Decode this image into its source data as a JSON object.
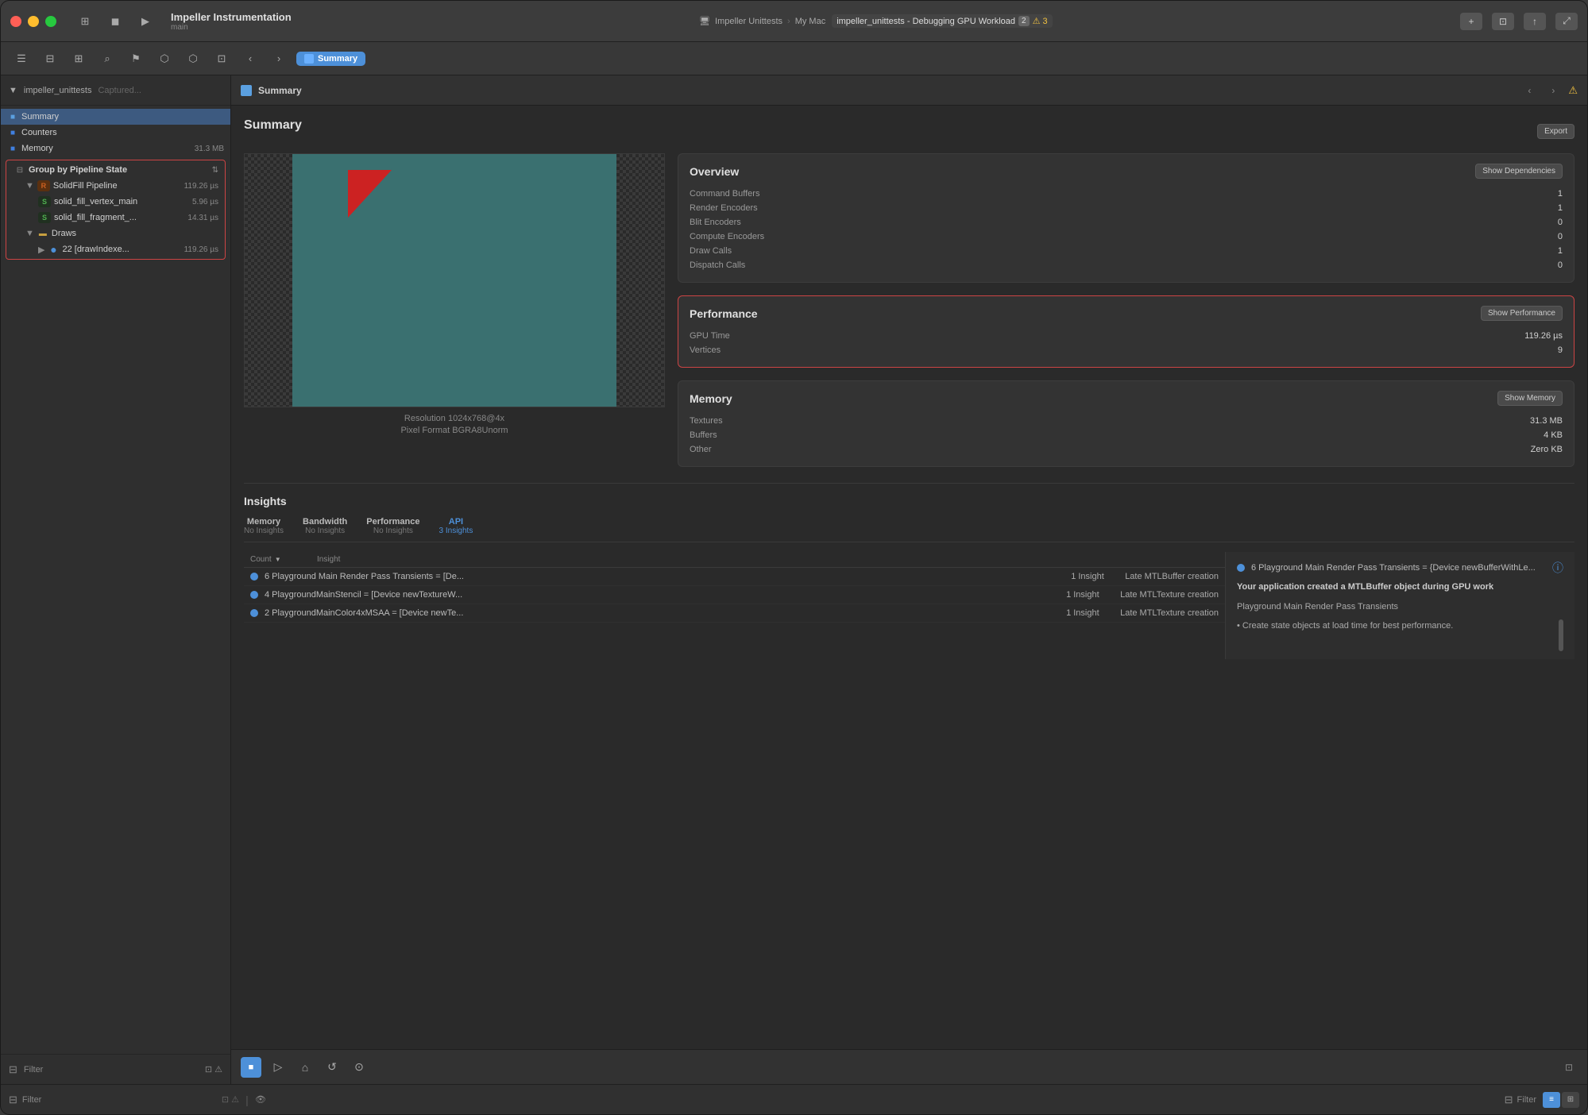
{
  "window": {
    "title": "Impeller Instrumentation",
    "subtitle": "main"
  },
  "titlebar": {
    "breadcrumb": [
      "Impeller Unittests",
      "My Mac"
    ],
    "debug_label": "impeller_unittests - Debugging GPU Workload",
    "debug_count": "2",
    "warn_count": "3",
    "add_btn": "+",
    "split_btn": "⊡"
  },
  "toolbar": {
    "back_btn": "‹",
    "forward_btn": "›",
    "tab_label": "Summary",
    "tab_icon": "■"
  },
  "panel_header": {
    "title": "Summary"
  },
  "sidebar": {
    "project": "impeller_unittests",
    "project_suffix": "Captured...",
    "items": [
      {
        "id": "summary",
        "label": "Summary",
        "icon": "■",
        "icon_color": "blue",
        "selected": true
      },
      {
        "id": "counters",
        "label": "Counters",
        "icon": "■",
        "icon_color": "blue",
        "selected": false
      },
      {
        "id": "memory",
        "label": "Memory",
        "icon": "■",
        "icon_color": "blue",
        "value": "31.3 MB",
        "selected": false
      }
    ],
    "group_label": "Group by Pipeline State",
    "pipeline": {
      "label": "SolidFill Pipeline",
      "value": "119.26 µs",
      "icon": "R"
    },
    "shaders": [
      {
        "label": "solid_fill_vertex_main",
        "value": "5.96 µs",
        "icon": "S"
      },
      {
        "label": "solid_fill_fragment_...",
        "value": "14.31 µs",
        "icon": "S"
      }
    ],
    "draws_label": "Draws",
    "draw_call": {
      "label": "22 [drawIndexe...",
      "value": "119.26 µs",
      "icon": "●"
    },
    "filter_label": "Filter"
  },
  "main": {
    "summary_title": "Summary",
    "export_btn": "Export",
    "preview": {
      "resolution": "Resolution  1024x768@4x",
      "pixel_format": "Pixel Format  BGRA8Unorm"
    },
    "overview": {
      "title": "Overview",
      "show_deps_btn": "Show Dependencies",
      "stats": [
        {
          "label": "Command Buffers",
          "value": "1"
        },
        {
          "label": "Render Encoders",
          "value": "1"
        },
        {
          "label": "Blit Encoders",
          "value": "0"
        },
        {
          "label": "Compute Encoders",
          "value": "0"
        },
        {
          "label": "Draw Calls",
          "value": "1"
        },
        {
          "label": "Dispatch Calls",
          "value": "0"
        }
      ]
    },
    "performance": {
      "title": "Performance",
      "show_perf_btn": "Show Performance",
      "stats": [
        {
          "label": "GPU Time",
          "value": "119.26 µs"
        },
        {
          "label": "Vertices",
          "value": "9"
        }
      ]
    },
    "memory": {
      "title": "Memory",
      "show_mem_btn": "Show Memory",
      "stats": [
        {
          "label": "Textures",
          "value": "31.3 MB"
        },
        {
          "label": "Buffers",
          "value": "4 KB"
        },
        {
          "label": "Other",
          "value": "Zero KB"
        }
      ]
    },
    "insights": {
      "title": "Insights",
      "tabs": [
        {
          "label": "Memory",
          "sub": "No Insights",
          "active": false
        },
        {
          "label": "Bandwidth",
          "sub": "No Insights",
          "active": false
        },
        {
          "label": "Performance",
          "sub": "No Insights",
          "active": false
        },
        {
          "label": "API",
          "sub": "3 Insights",
          "active": true
        }
      ],
      "table_headers": {
        "count": "Count",
        "insight": "Insight"
      },
      "rows": [
        {
          "text": "6 Playground Main Render Pass Transients = [De...",
          "count": "1 Insight",
          "type": "Late MTLBuffer creation"
        },
        {
          "text": "4 PlaygroundMainStencil = [Device newTextureW...",
          "count": "1 Insight",
          "type": "Late MTLTexture creation"
        },
        {
          "text": "2 PlaygroundMainColor4xMSAA = [Device newTe...",
          "count": "1 Insight",
          "type": "Late MTLTexture creation"
        }
      ],
      "detail": {
        "title": "6 Playground Main Render Pass Transients = {Device newBufferWithLe...",
        "status_icon": "ⓘ",
        "description": "Your application created a MTLBuffer object during GPU work",
        "sub_label": "Playground Main Render Pass Transients",
        "tip": "• Create state objects at load time for best performance."
      }
    }
  },
  "bottom_toolbar": {
    "record_btn": "■",
    "play_btn": "▷",
    "camera_btn": "⌥",
    "refresh_btn": "↺",
    "time_btn": "⊙"
  },
  "status_bar": {
    "filter_label": "Filter",
    "filter_label_right": "Filter"
  }
}
